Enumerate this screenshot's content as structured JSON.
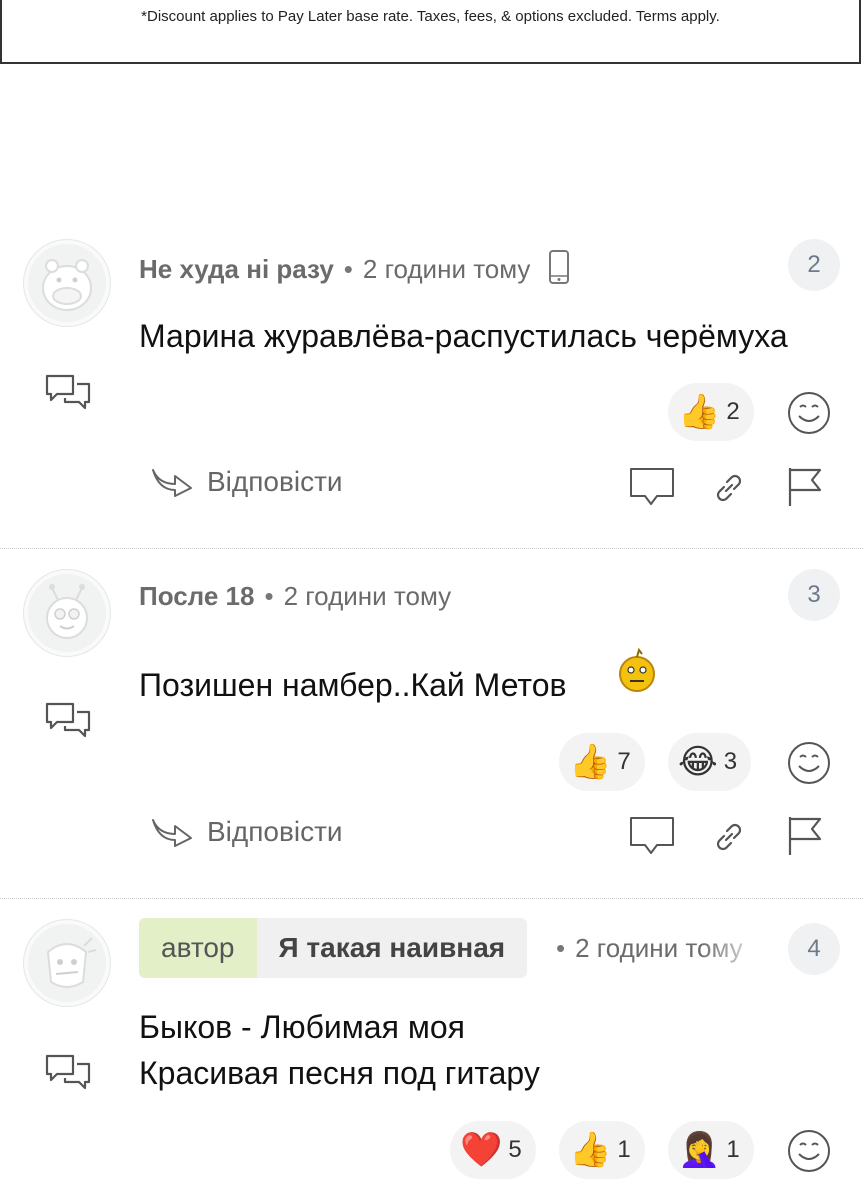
{
  "banner": {
    "text": "*Discount applies to Pay Later base rate. Taxes, fees, & options excluded. Terms apply."
  },
  "comments": [
    {
      "name": "Не худа ні разу",
      "time": "2 години тому",
      "number": "2",
      "text_lines": [
        "Марина журавлёва-распустилась черёмуха"
      ],
      "reactions": [
        {
          "emoji": "👍",
          "count": "2"
        }
      ],
      "reply_label": "Відповісти",
      "device_icon": "phone-icon"
    },
    {
      "name": "После 18",
      "time": "2 години тому",
      "number": "3",
      "text_lines": [
        "Позишен намбер..Кай Метов"
      ],
      "reactions": [
        {
          "emoji": "👍",
          "count": "7"
        },
        {
          "emoji": "😂",
          "count": "3"
        }
      ],
      "reply_label": "Відповісти"
    },
    {
      "role": "автор",
      "name": "Я такая наивная",
      "time": "2 години тому",
      "number": "4",
      "text_lines": [
        "Быков - Любимая моя",
        "Красивая песня под гитару"
      ],
      "reactions": [
        {
          "emoji": "❤️",
          "count": "5"
        },
        {
          "emoji": "👍",
          "count": "1"
        },
        {
          "emoji": "🤦‍♀️",
          "count": "1"
        }
      ]
    }
  ],
  "colors": {
    "author_badge": "#e3efc6",
    "name_badge": "#f0f0f0",
    "reaction_bg": "#f3f3f3",
    "number_bg": "#f0f1f3"
  }
}
